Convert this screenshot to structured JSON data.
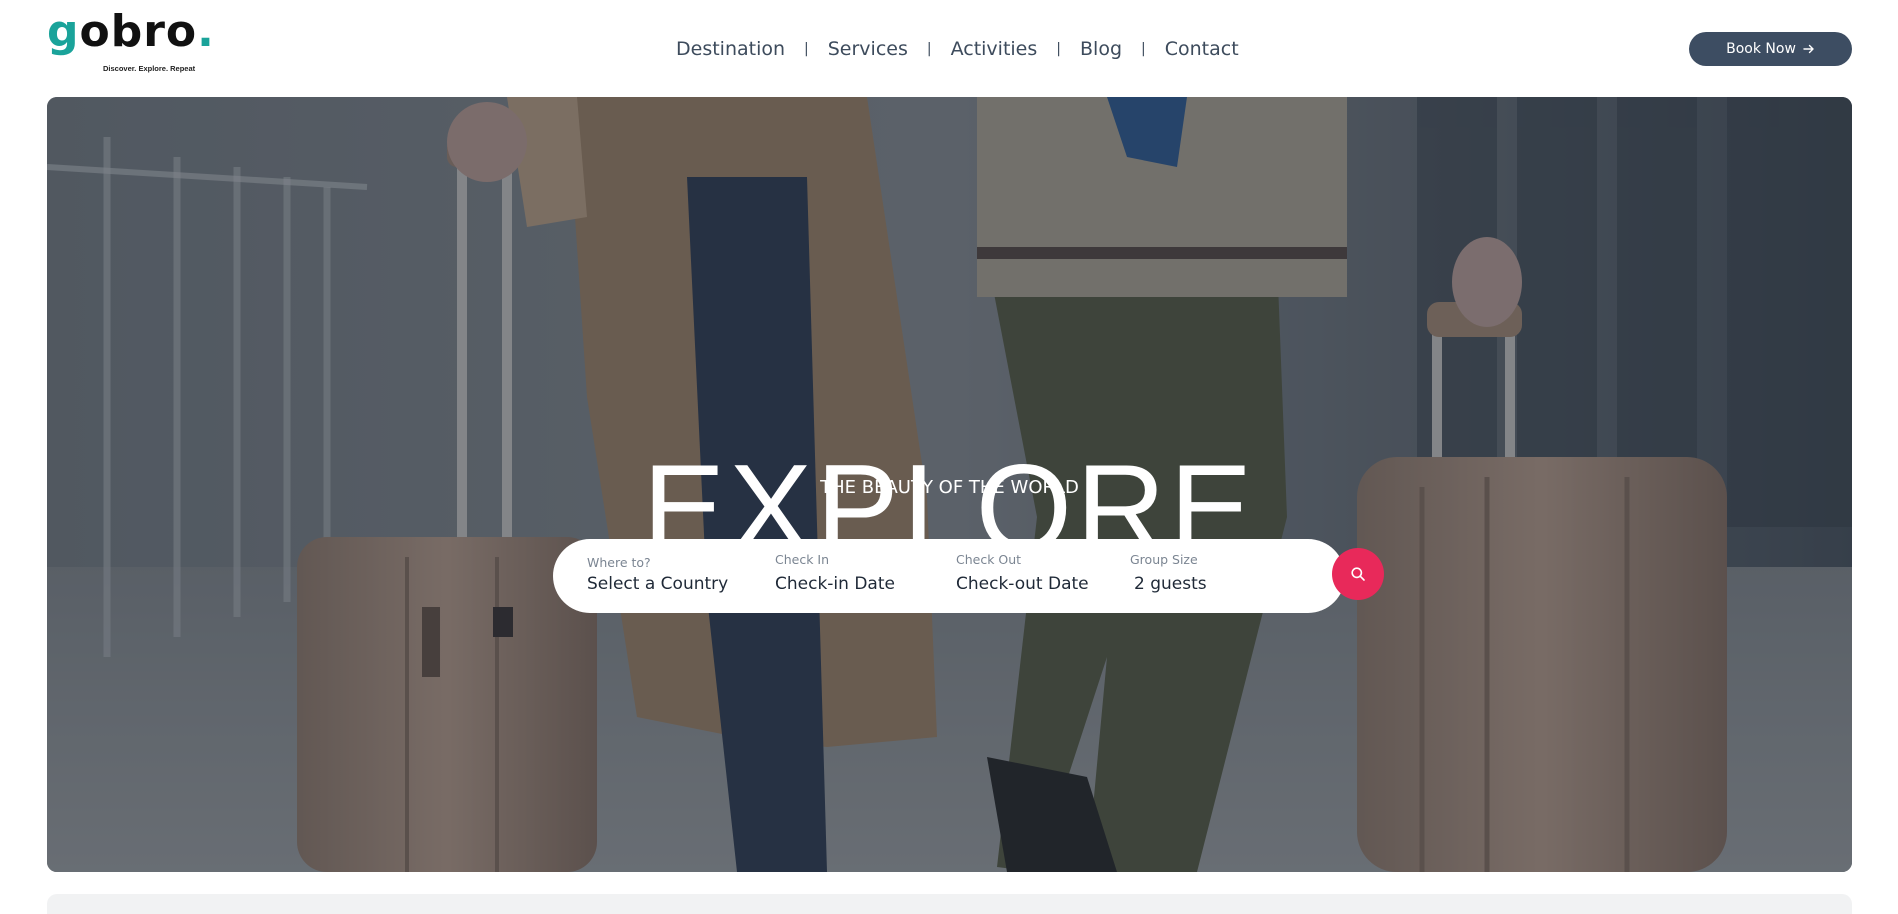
{
  "brand": {
    "logo_text": "gobro.",
    "tagline": "Discover. Explore. Repeat"
  },
  "nav": {
    "items": [
      {
        "label": "Destination"
      },
      {
        "label": "Services"
      },
      {
        "label": "Activities"
      },
      {
        "label": "Blog"
      },
      {
        "label": "Contact"
      }
    ],
    "separator": "|"
  },
  "header": {
    "book_label": "Book Now"
  },
  "hero": {
    "title": "EXPLORE",
    "subtitle": "THE BEAUTY OF THE WORLD"
  },
  "search": {
    "where": {
      "label": "Where to?",
      "value": "Select a Country"
    },
    "check_in": {
      "label": "Check In",
      "value": "Check-in Date"
    },
    "check_out": {
      "label": "Check Out",
      "value": "Check-out Date"
    },
    "group": {
      "label": "Group Size",
      "value": "2 guests"
    }
  },
  "colors": {
    "brand_teal": "#1aa39a",
    "book_button": "#3d4d62",
    "search_button": "#e8295a",
    "nav_text": "#3d4b5c"
  },
  "icons": {
    "book_arrow": "arrow-right-icon",
    "search": "search-icon"
  }
}
